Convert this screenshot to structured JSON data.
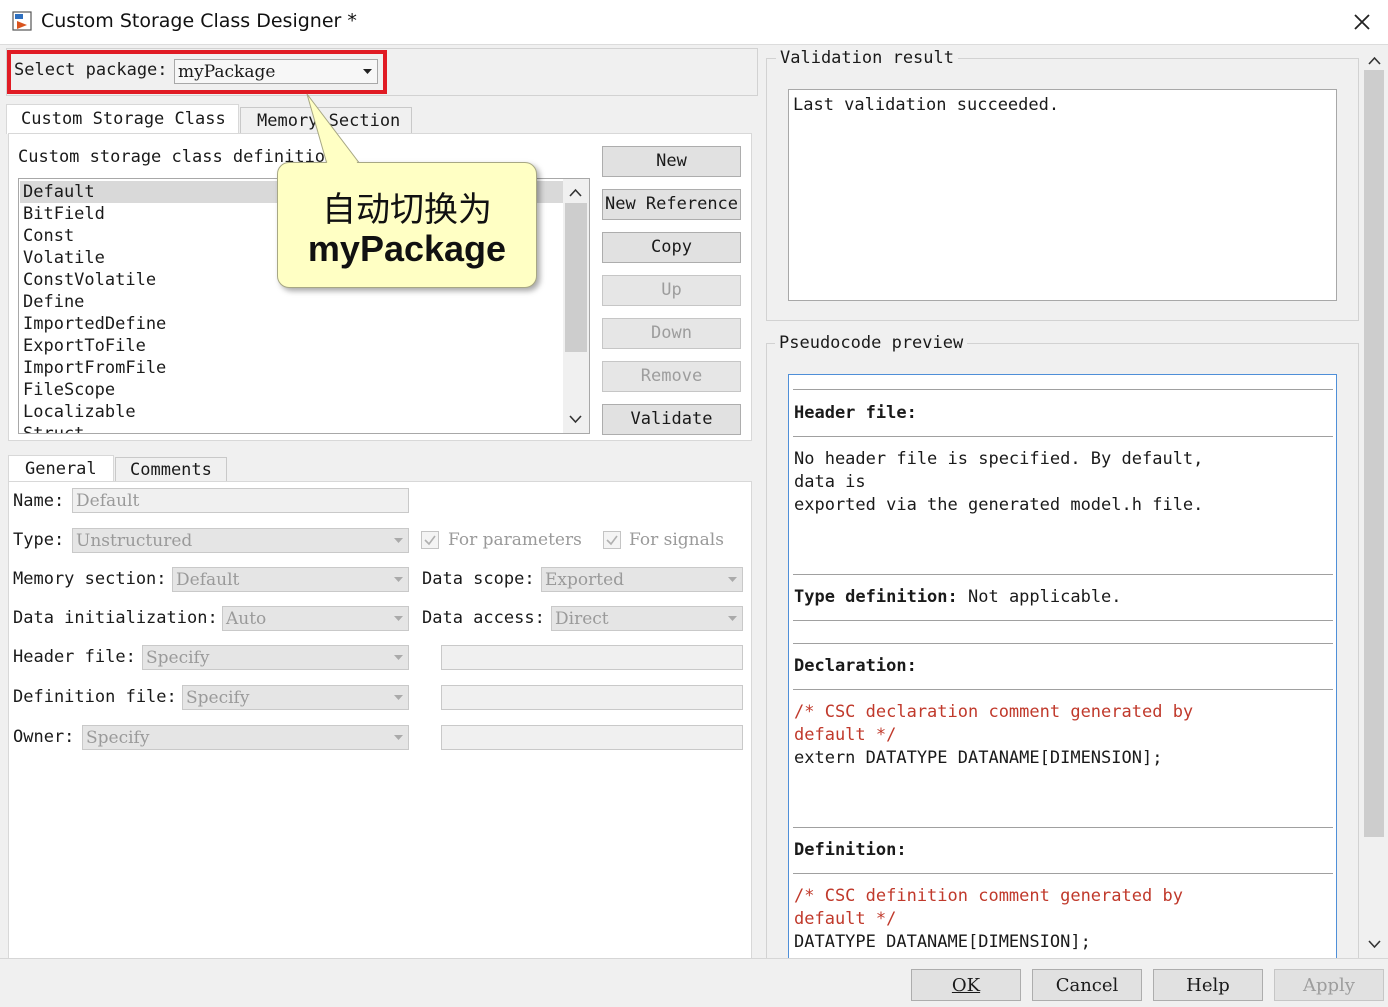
{
  "window": {
    "title": "Custom Storage Class Designer *"
  },
  "package": {
    "label": "Select package:",
    "value": "myPackage"
  },
  "tabs": [
    {
      "label": "Custom Storage Class"
    },
    {
      "label": "Memory Section"
    }
  ],
  "csc": {
    "legend": "Custom storage class definitions",
    "items": [
      "Default",
      "BitField",
      "Const",
      "Volatile",
      "ConstVolatile",
      "Define",
      "ImportedDefine",
      "ExportToFile",
      "ImportFromFile",
      "FileScope",
      "Localizable",
      "Struct"
    ],
    "selected": "Default",
    "buttons": {
      "new": "New",
      "new_reference": "New Reference",
      "copy": "Copy",
      "up": "Up",
      "down": "Down",
      "remove": "Remove",
      "validate": "Validate"
    }
  },
  "callout": {
    "line1": "自动切换为",
    "line2": "myPackage"
  },
  "subtabs": [
    {
      "label": "General"
    },
    {
      "label": "Comments"
    }
  ],
  "general": {
    "name_label": "Name:",
    "name_value": "Default",
    "type_label": "Type:",
    "type_value": "Unstructured",
    "for_parameters": "For parameters",
    "for_signals": "For signals",
    "memory_section_label": "Memory section:",
    "memory_section_value": "Default",
    "data_scope_label": "Data scope:",
    "data_scope_value": "Exported",
    "data_init_label": "Data initialization:",
    "data_init_value": "Auto",
    "data_access_label": "Data access:",
    "data_access_value": "Direct",
    "header_file_label": "Header file:",
    "header_file_value": "Specify",
    "definition_file_label": "Definition file:",
    "definition_file_value": "Specify",
    "owner_label": "Owner:",
    "owner_value": "Specify"
  },
  "validation": {
    "legend": "Validation result",
    "text": "Last validation succeeded."
  },
  "pseudocode": {
    "legend": "Pseudocode preview",
    "header_title": "Header file:",
    "header_lines": [
      "No header file is specified. By default,",
      "data is",
      "exported via the generated model.h file."
    ],
    "type_title": "Type definition:",
    "type_text": " Not applicable.",
    "decl_title": "Declaration:",
    "decl_comment": [
      "/* CSC declaration comment generated by",
      "default */"
    ],
    "decl_code": "extern DATATYPE DATANAME[DIMENSION];",
    "def_title": "Definition:",
    "def_comment": [
      "/* CSC definition comment generated by",
      "default */"
    ],
    "def_code": "DATATYPE DATANAME[DIMENSION];"
  },
  "bottom_buttons": {
    "ok": "OK",
    "cancel": "Cancel",
    "help": "Help",
    "apply": "Apply"
  },
  "colors": {
    "highlight": "#e01b24",
    "callout_bg": "#ffffc4",
    "comment_red": "#c0392b",
    "focus_blue": "#4f8fd8"
  }
}
